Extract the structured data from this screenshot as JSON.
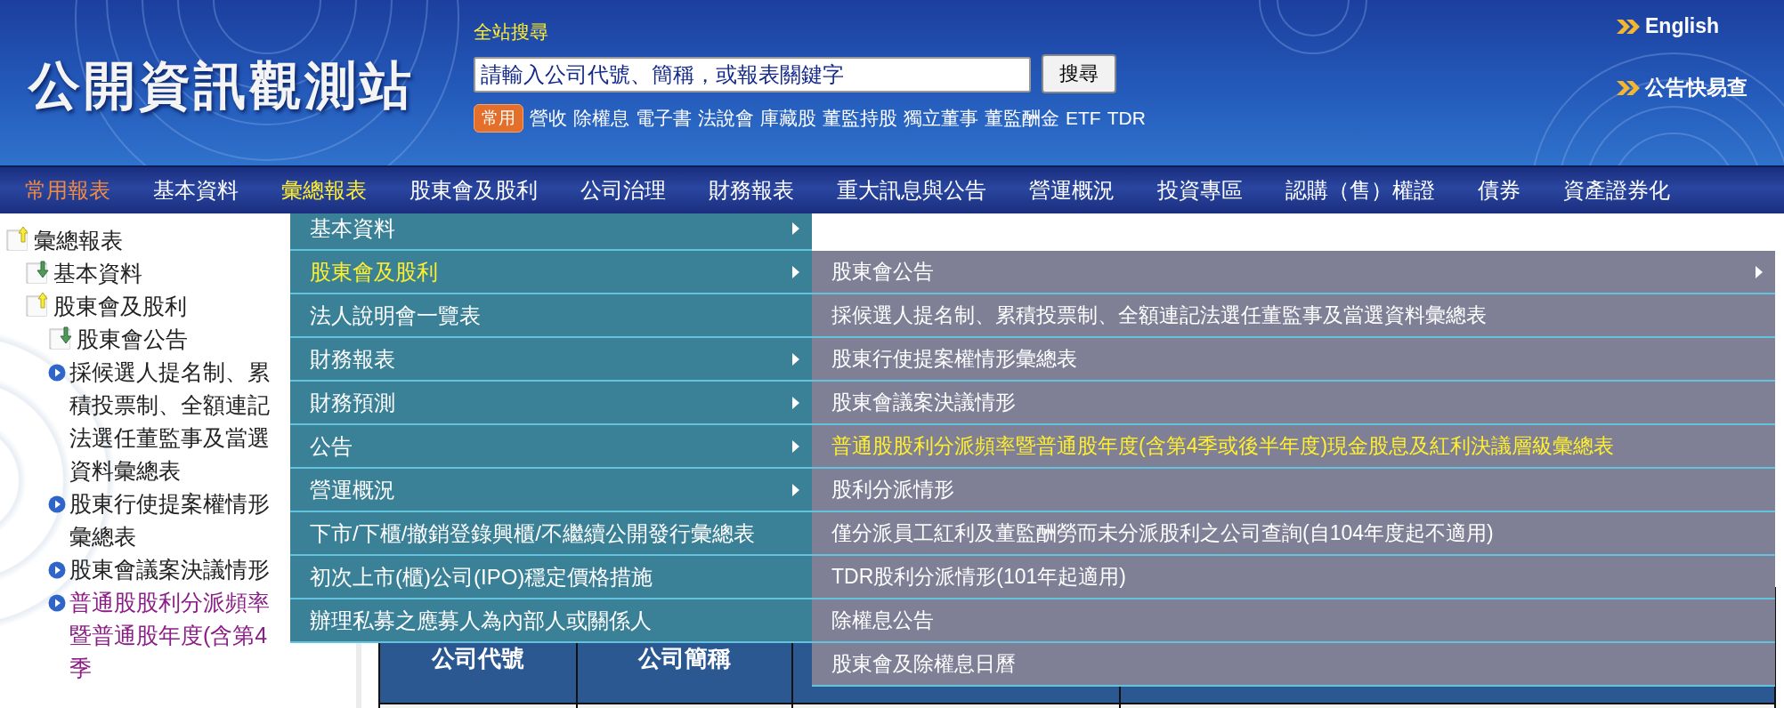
{
  "header": {
    "logo": "公開資訊觀測站",
    "search_label": "全站搜尋",
    "search": {
      "value": "請輸入公司代號、簡稱，或報表關鍵字"
    },
    "search_button": "搜尋",
    "quick_badge": "常用",
    "quick_links": [
      "營收",
      "除權息",
      "電子書",
      "法說會",
      "庫藏股",
      "董監持股",
      "獨立董事",
      "董監酬金",
      "ETF",
      "TDR"
    ],
    "links": [
      "English",
      "公告快易查"
    ]
  },
  "nav": [
    {
      "label": "常用報表",
      "selected": false,
      "featured": true
    },
    {
      "label": "基本資料",
      "selected": false,
      "featured": false
    },
    {
      "label": "彙總報表",
      "selected": true,
      "featured": false
    },
    {
      "label": "股東會及股利",
      "selected": false,
      "featured": false
    },
    {
      "label": "公司治理",
      "selected": false,
      "featured": false
    },
    {
      "label": "財務報表",
      "selected": false,
      "featured": false
    },
    {
      "label": "重大訊息與公告",
      "selected": false,
      "featured": false
    },
    {
      "label": "營運概況",
      "selected": false,
      "featured": false
    },
    {
      "label": "投資專區",
      "selected": false,
      "featured": false
    },
    {
      "label": "認購（售）權證",
      "selected": false,
      "featured": false
    },
    {
      "label": "債券",
      "selected": false,
      "featured": false
    },
    {
      "label": "資產證券化",
      "selected": false,
      "featured": false
    }
  ],
  "tree": [
    {
      "label": "彙總報表",
      "kind": "folder",
      "expanded": true,
      "children": [
        {
          "label": "基本資料",
          "kind": "folder",
          "expanded": false
        },
        {
          "label": "股東會及股利",
          "kind": "folder",
          "expanded": true,
          "children": [
            {
              "label": "股東會公告",
              "kind": "folder",
              "expanded": false
            },
            {
              "label": "採候選人提名制、累積投票制、全額連記法選任董監事及當選資料彙總表",
              "kind": "leaf",
              "visited": false
            },
            {
              "label": "股東行使提案權情形彙總表",
              "kind": "leaf",
              "visited": false
            },
            {
              "label": "股東會議案決議情形",
              "kind": "leaf",
              "visited": false
            },
            {
              "label": "普通股股利分派頻率暨普通股年度(含第4季",
              "kind": "leaf",
              "visited": true
            }
          ]
        }
      ]
    }
  ],
  "menu": {
    "items": [
      {
        "label": "基本資料",
        "selected": false,
        "submenu": true
      },
      {
        "label": "股東會及股利",
        "selected": true,
        "submenu": true
      },
      {
        "label": "法人說明會一覽表",
        "selected": false,
        "submenu": false
      },
      {
        "label": "財務報表",
        "selected": false,
        "submenu": true
      },
      {
        "label": "財務預測",
        "selected": false,
        "submenu": true
      },
      {
        "label": "公告",
        "selected": false,
        "submenu": true
      },
      {
        "label": "營運概況",
        "selected": false,
        "submenu": true
      },
      {
        "label": "下市/下櫃/撤銷登錄興櫃/不繼續公開發行彙總表",
        "selected": false,
        "submenu": false
      },
      {
        "label": "初次上市(櫃)公司(IPO)穩定價格措施",
        "selected": false,
        "submenu": false
      },
      {
        "label": "辦理私募之應募人為內部人或關係人",
        "selected": false,
        "submenu": false
      }
    ]
  },
  "submenu": {
    "items": [
      {
        "label": "股東會公告",
        "selected": false,
        "submenu": true
      },
      {
        "label": "採候選人提名制、累積投票制、全額連記法選任董監事及當選資料彙總表",
        "selected": false,
        "submenu": false
      },
      {
        "label": "股東行使提案權情形彙總表",
        "selected": false,
        "submenu": false
      },
      {
        "label": "股東會議案決議情形",
        "selected": false,
        "submenu": false
      },
      {
        "label": "普通股股利分派頻率暨普通股年度(含第4季或後半年度)現金股息及紅利決議層級彙總表",
        "selected": true,
        "submenu": false
      },
      {
        "label": "股利分派情形",
        "selected": false,
        "submenu": false
      },
      {
        "label": "僅分派員工紅利及董監酬勞而未分派股利之公司查詢(自104年度起不適用)",
        "selected": false,
        "submenu": false
      },
      {
        "label": "TDR股利分派情形(101年起適用)",
        "selected": false,
        "submenu": false
      },
      {
        "label": "除權息公告",
        "selected": false,
        "submenu": false
      },
      {
        "label": "股東會及除權息日曆",
        "selected": false,
        "submenu": false
      }
    ]
  },
  "table": {
    "columns": [
      "公司代號",
      "公司簡稱"
    ]
  }
}
